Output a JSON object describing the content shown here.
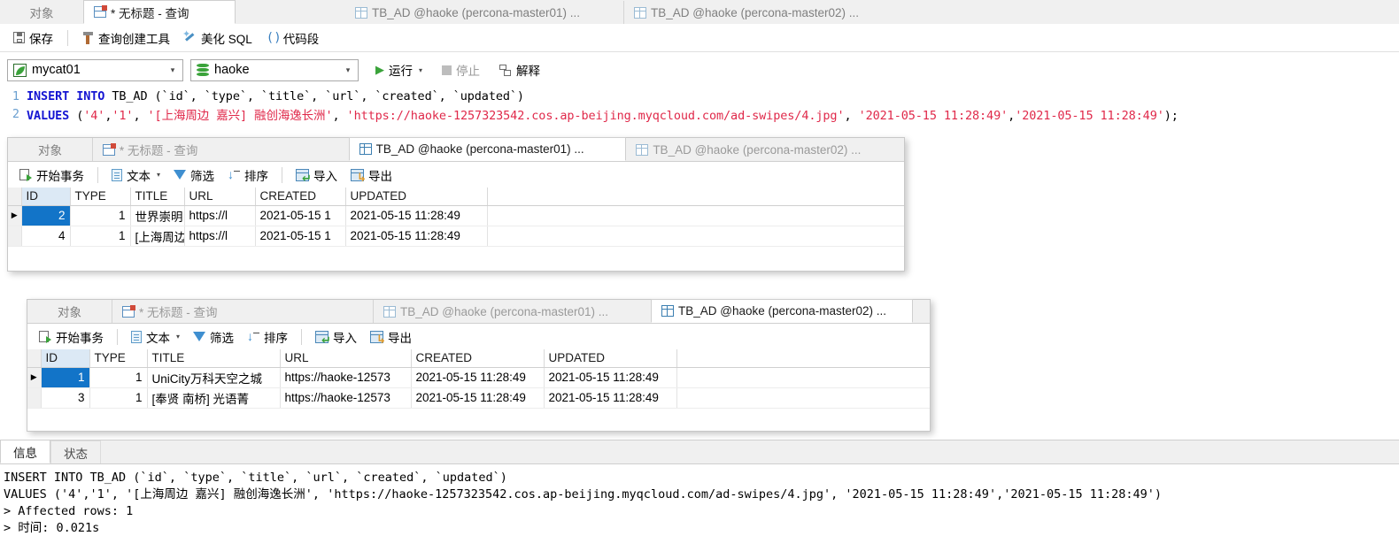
{
  "top_tabs": [
    {
      "label": "对象",
      "icon": "",
      "active": false
    },
    {
      "label": "* 无标题 - 查询",
      "icon": "query-icon",
      "active": true
    },
    {
      "label": "TB_AD @haoke (percona-master01) ...",
      "icon": "grid-icon",
      "active": false
    },
    {
      "label": "TB_AD @haoke (percona-master02) ...",
      "icon": "grid-icon",
      "active": false
    }
  ],
  "query_toolbar": {
    "save": "保存",
    "query_builder": "查询创建工具",
    "beautify_sql": "美化 SQL",
    "snippet": "代码段"
  },
  "connection_bar": {
    "connection": "mycat01",
    "database": "haoke",
    "run": "运行",
    "stop": "停止",
    "explain": "解释"
  },
  "editor": {
    "lines": [
      {
        "no": "1",
        "segments": [
          {
            "t": "INSERT INTO ",
            "c": "kw"
          },
          {
            "t": "TB_AD ",
            "c": "ident"
          },
          {
            "t": "(`id`, `type`, `title`, `url`, `created`, `updated`)",
            "c": "punc"
          }
        ]
      },
      {
        "no": "2",
        "segments": [
          {
            "t": "VALUES ",
            "c": "kw"
          },
          {
            "t": "(",
            "c": "punc"
          },
          {
            "t": "'4'",
            "c": "str"
          },
          {
            "t": ",",
            "c": "punc"
          },
          {
            "t": "'1'",
            "c": "str"
          },
          {
            "t": ", ",
            "c": "punc"
          },
          {
            "t": "'[上海周边 嘉兴] 融创海逸长洲'",
            "c": "str"
          },
          {
            "t": ", ",
            "c": "punc"
          },
          {
            "t": "'https://haoke-1257323542.cos.ap-beijing.myqcloud.com/ad-swipes/4.jpg'",
            "c": "str"
          },
          {
            "t": ", ",
            "c": "punc"
          },
          {
            "t": "'2021-05-15 11:28:49'",
            "c": "str"
          },
          {
            "t": ",",
            "c": "punc"
          },
          {
            "t": "'2021-05-15 11:28:49'",
            "c": "str"
          },
          {
            "t": ");",
            "c": "punc"
          }
        ]
      }
    ]
  },
  "result_toolbar": {
    "begin_transaction": "开始事务",
    "text": "文本",
    "filter": "筛选",
    "sort": "排序",
    "import": "导入",
    "export": "导出"
  },
  "panel1": {
    "tabs": [
      {
        "label": "对象",
        "icon": "",
        "active": false
      },
      {
        "label": "* 无标题 - 查询",
        "icon": "query-icon",
        "active": false
      },
      {
        "label": "TB_AD @haoke (percona-master01) ...",
        "icon": "grid-icon",
        "active": true
      },
      {
        "label": "TB_AD @haoke (percona-master02) ...",
        "icon": "grid-icon",
        "active": false
      }
    ],
    "columns": [
      "ID",
      "TYPE",
      "TITLE",
      "URL",
      "CREATED",
      "UPDATED"
    ],
    "rows": [
      {
        "selected": true,
        "id": "2",
        "type": "1",
        "title": "世界崇明",
        "url": "https://l",
        "created": "2021-05-15 1",
        "updated": "2021-05-15 11:28:49"
      },
      {
        "selected": false,
        "id": "4",
        "type": "1",
        "title": "[上海周边",
        "url": "https://l",
        "created": "2021-05-15 1",
        "updated": "2021-05-15 11:28:49"
      }
    ]
  },
  "panel2": {
    "tabs": [
      {
        "label": "对象",
        "icon": "",
        "active": false
      },
      {
        "label": "* 无标题 - 查询",
        "icon": "query-icon",
        "active": false
      },
      {
        "label": "TB_AD @haoke (percona-master01) ...",
        "icon": "grid-icon",
        "active": false
      },
      {
        "label": "TB_AD @haoke (percona-master02) ...",
        "icon": "grid-icon",
        "active": true
      }
    ],
    "columns": [
      "ID",
      "TYPE",
      "TITLE",
      "URL",
      "CREATED",
      "UPDATED"
    ],
    "rows": [
      {
        "selected": true,
        "id": "1",
        "type": "1",
        "title": "UniCity万科天空之城",
        "url": "https://haoke-12573",
        "created": "2021-05-15 11:28:49",
        "updated": "2021-05-15 11:28:49"
      },
      {
        "selected": false,
        "id": "3",
        "type": "1",
        "title": "[奉贤 南桥] 光语菁",
        "url": "https://haoke-12573",
        "created": "2021-05-15 11:28:49",
        "updated": "2021-05-15 11:28:49"
      }
    ]
  },
  "info": {
    "tabs": [
      {
        "label": "信息",
        "active": true
      },
      {
        "label": "状态",
        "active": false
      }
    ],
    "lines": [
      "INSERT INTO TB_AD (`id`, `type`, `title`, `url`, `created`, `updated`)",
      "VALUES ('4','1', '[上海周边 嘉兴] 融创海逸长洲', 'https://haoke-1257323542.cos.ap-beijing.myqcloud.com/ad-swipes/4.jpg', '2021-05-15 11:28:49','2021-05-15 11:28:49')",
      "> Affected rows: 1",
      "> 时间: 0.021s"
    ]
  },
  "colors": {
    "selection_blue": "#1274c8",
    "id_header_blue": "#dce9f5",
    "keyword_blue": "#1414d2",
    "string_red": "#e0294a",
    "green_accent": "#3aa33a"
  }
}
